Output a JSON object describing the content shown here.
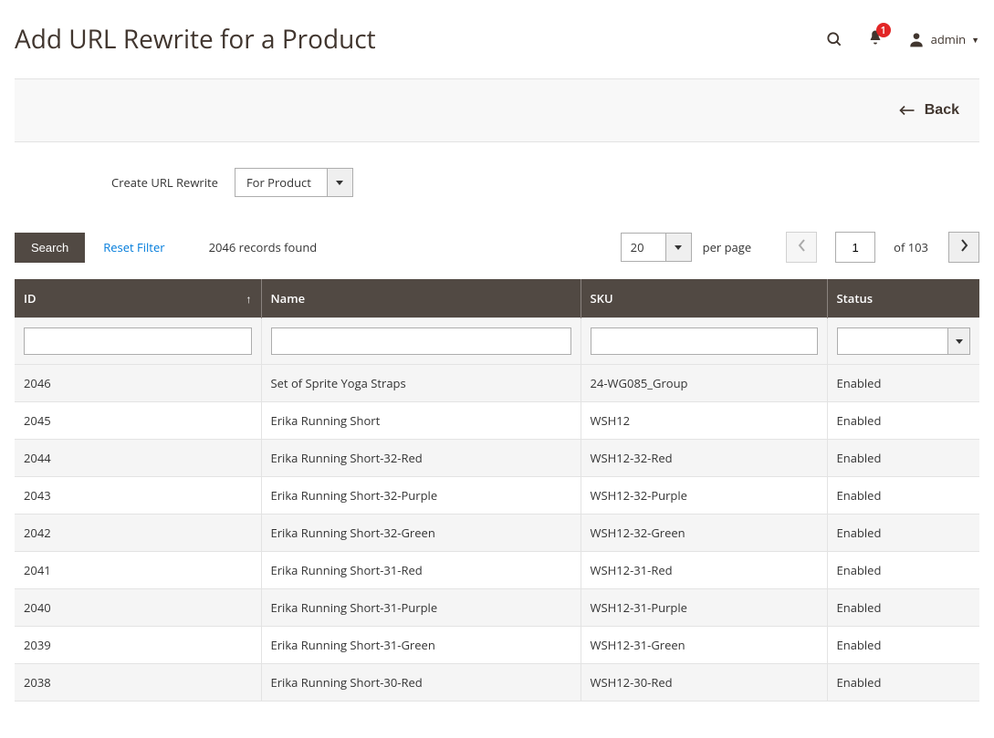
{
  "header": {
    "title": "Add URL Rewrite for a Product",
    "notifications_count": "1",
    "admin_label": "admin"
  },
  "actionbar": {
    "back_label": "Back"
  },
  "rewrite": {
    "label": "Create URL Rewrite",
    "selected": "For Product"
  },
  "toolbar": {
    "search_label": "Search",
    "reset_label": "Reset Filter",
    "records_found": "2046 records found",
    "per_page_value": "20",
    "per_page_label": "per page",
    "current_page": "1",
    "of_pages_label": "of 103"
  },
  "grid": {
    "columns": {
      "id": "ID",
      "name": "Name",
      "sku": "SKU",
      "status": "Status"
    },
    "rows": [
      {
        "id": "2046",
        "name": "Set of Sprite Yoga Straps",
        "sku": "24-WG085_Group",
        "status": "Enabled"
      },
      {
        "id": "2045",
        "name": "Erika Running Short",
        "sku": "WSH12",
        "status": "Enabled"
      },
      {
        "id": "2044",
        "name": "Erika Running Short-32-Red",
        "sku": "WSH12-32-Red",
        "status": "Enabled"
      },
      {
        "id": "2043",
        "name": "Erika Running Short-32-Purple",
        "sku": "WSH12-32-Purple",
        "status": "Enabled"
      },
      {
        "id": "2042",
        "name": "Erika Running Short-32-Green",
        "sku": "WSH12-32-Green",
        "status": "Enabled"
      },
      {
        "id": "2041",
        "name": "Erika Running Short-31-Red",
        "sku": "WSH12-31-Red",
        "status": "Enabled"
      },
      {
        "id": "2040",
        "name": "Erika Running Short-31-Purple",
        "sku": "WSH12-31-Purple",
        "status": "Enabled"
      },
      {
        "id": "2039",
        "name": "Erika Running Short-31-Green",
        "sku": "WSH12-31-Green",
        "status": "Enabled"
      },
      {
        "id": "2038",
        "name": "Erika Running Short-30-Red",
        "sku": "WSH12-30-Red",
        "status": "Enabled"
      }
    ]
  }
}
